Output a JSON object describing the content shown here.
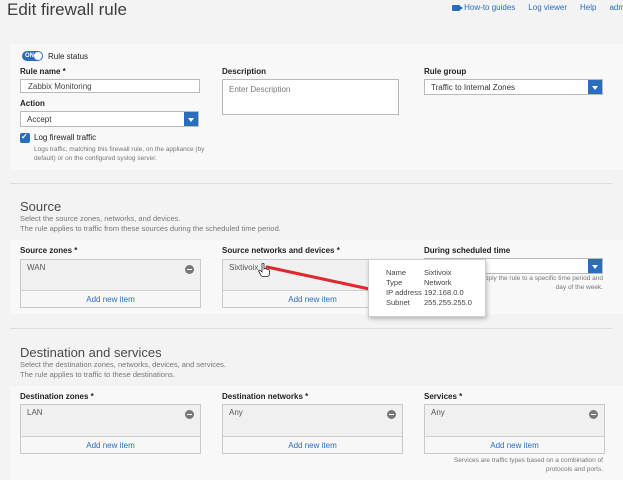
{
  "header": {
    "title": "Edit firewall rule",
    "links": [
      "How-to guides",
      "Log viewer",
      "Help",
      "adm"
    ]
  },
  "rule": {
    "status_toggle": "ON",
    "status_label": "Rule status",
    "name_label": "Rule name *",
    "name_value": "Zabbix Monitoring",
    "description_label": "Description",
    "description_placeholder": "Enter Description",
    "group_label": "Rule group",
    "group_value": "Traffic to Internal Zones",
    "action_label": "Action",
    "action_value": "Accept",
    "log_label": "Log firewall traffic",
    "log_help": "Logs traffic, matching this firewall rule, on the appliance (by default) or on the configured syslog server."
  },
  "source": {
    "title": "Source",
    "desc_line1": "Select the source zones, networks, and devices.",
    "desc_line2": "The rule applies to traffic from these sources during the scheduled time period.",
    "zones_label": "Source zones *",
    "zones_item": "WAN",
    "networks_label": "Source networks and devices *",
    "networks_item": "Sixtivoix",
    "schedule_label": "During scheduled time",
    "schedule_note": "Apply the rule to a specific time period and day of the week.",
    "add_new": "Add new item"
  },
  "tooltip": {
    "rows": [
      {
        "key": "Name",
        "value": "Sixtivoix"
      },
      {
        "key": "Type",
        "value": "Network"
      },
      {
        "key": "IP address",
        "value": "192.168.0.0"
      },
      {
        "key": "Subnet",
        "value": "255.255.255.0"
      }
    ]
  },
  "destination": {
    "title": "Destination and services",
    "desc_line1": "Select the destination zones, networks, devices, and services.",
    "desc_line2": "The rule applies to traffic to these destinations.",
    "zones_label": "Destination zones *",
    "zones_item": "LAN",
    "networks_label": "Destination networks *",
    "networks_item": "Any",
    "services_label": "Services *",
    "services_item": "Any",
    "services_note": "Services are traffic types based on a combination of protocols and ports.",
    "add_new": "Add new item"
  },
  "colors": {
    "accent": "#2a6ebb",
    "arrow": "#e0282e"
  }
}
